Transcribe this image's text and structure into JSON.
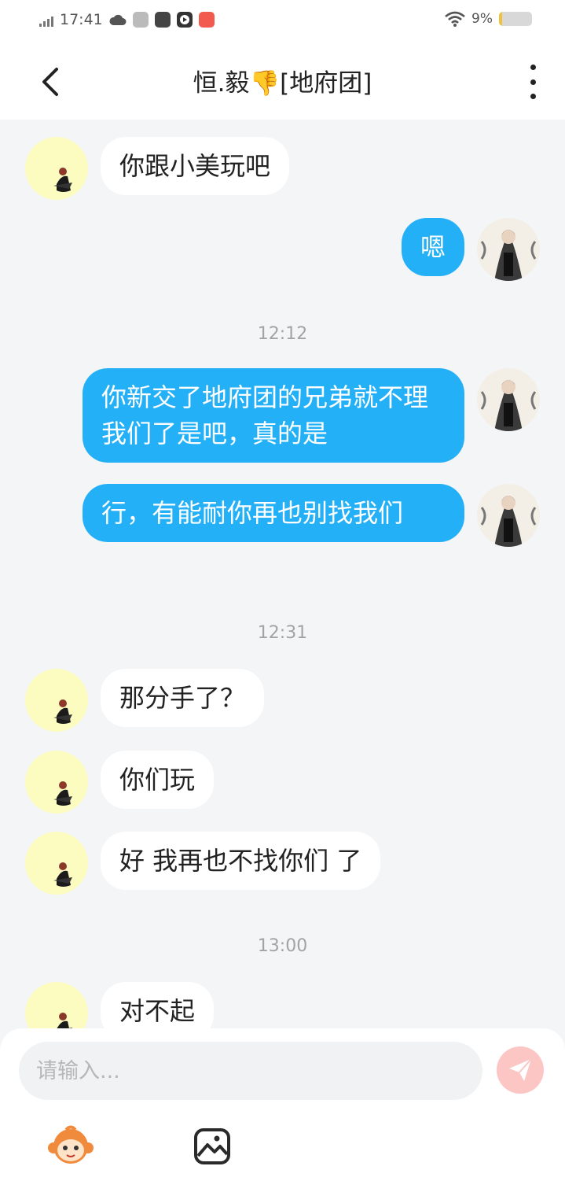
{
  "status_bar": {
    "time": "17:41",
    "battery": "9%",
    "battery_level": 0.09
  },
  "header": {
    "title": "恒.毅👎[地府团]"
  },
  "messages": [
    {
      "from": "them",
      "text": "你跟小美玩吧"
    },
    {
      "from": "me",
      "text": "嗯"
    },
    {
      "time": "12:12"
    },
    {
      "from": "me",
      "text": "你新交了地府团的兄弟就不理我们了是吧，真的是"
    },
    {
      "from": "me",
      "text": "行，有能耐你再也别找我们"
    },
    {
      "time": "12:31"
    },
    {
      "from": "them",
      "text": "那分手了？"
    },
    {
      "from": "them",
      "text": "你们玩"
    },
    {
      "from": "them",
      "text": "好 我再也不找你们 了"
    },
    {
      "time": "13:00"
    },
    {
      "from": "them",
      "text": "对不起"
    }
  ],
  "input": {
    "placeholder": "请输入..."
  },
  "icons": {
    "back": "chevron-left-icon",
    "more": "more-vertical-icon",
    "send": "send-icon",
    "emoji": "emoji-monkey-icon",
    "image": "image-icon"
  },
  "colors": {
    "my_bubble": "#24b0f7",
    "their_bubble": "#ffffff",
    "background": "#f4f5f7",
    "send_button": "#fbc6c4"
  }
}
